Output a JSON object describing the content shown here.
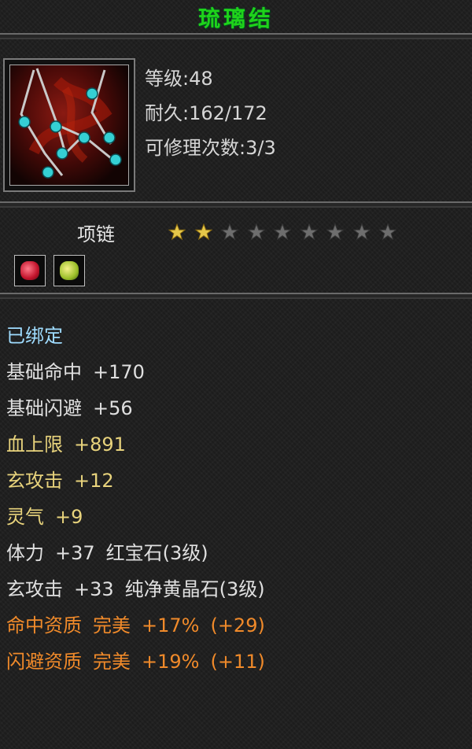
{
  "item": {
    "name": "琉璃结",
    "type": "项链",
    "icon": "necklace-icon",
    "stats": [
      {
        "label": "等级",
        "value": "48"
      },
      {
        "label": "耐久",
        "value": "162/172"
      },
      {
        "label": "可修理次数",
        "value": "3/3"
      }
    ],
    "stars": {
      "filled": 2,
      "total": 9
    },
    "gems": [
      "ruby-gem-icon",
      "yellow-crystal-gem-icon"
    ]
  },
  "attributes": [
    {
      "parts": [
        "已绑定"
      ],
      "color": "bound"
    },
    {
      "parts": [
        "基础命中",
        "+170"
      ],
      "color": "white"
    },
    {
      "parts": [
        "基础闪避",
        "+56"
      ],
      "color": "white"
    },
    {
      "parts": [
        "血上限",
        "+891"
      ],
      "color": "yellow"
    },
    {
      "parts": [
        "玄攻击",
        "+12"
      ],
      "color": "yellow"
    },
    {
      "parts": [
        "灵气",
        "+9"
      ],
      "color": "yellow"
    },
    {
      "parts": [
        "体力",
        "+37",
        "红宝石(3级)"
      ],
      "color": "white"
    },
    {
      "parts": [
        "玄攻击",
        "+33",
        "纯净黄晶石(3级)"
      ],
      "color": "white"
    },
    {
      "parts": [
        "命中资质",
        "完美",
        "+17%",
        "(+29)"
      ],
      "color": "orange"
    },
    {
      "parts": [
        "闪避资质",
        "完美",
        "+19%",
        "(+11)"
      ],
      "color": "orange"
    }
  ],
  "colors": {
    "title": "#1fd31a",
    "bound": "#9fdcff",
    "white": "#e0e0e0",
    "yellow": "#e8d37c",
    "orange": "#f08a2a",
    "star_filled": "#e6c84a",
    "star_empty": "#6e6e6e"
  }
}
